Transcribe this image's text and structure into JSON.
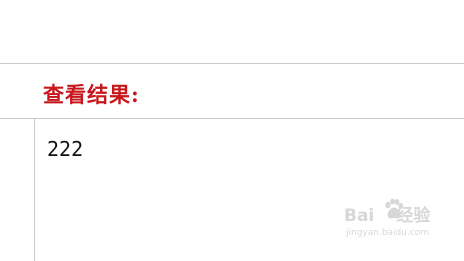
{
  "result": {
    "heading": "查看结果:",
    "output": "222"
  },
  "watermark": {
    "brand_left": "Bai",
    "brand_right": "经验",
    "url": "jingyan.baidu.com"
  },
  "colors": {
    "heading": "#c8161d",
    "border": "#c9c9c9"
  }
}
